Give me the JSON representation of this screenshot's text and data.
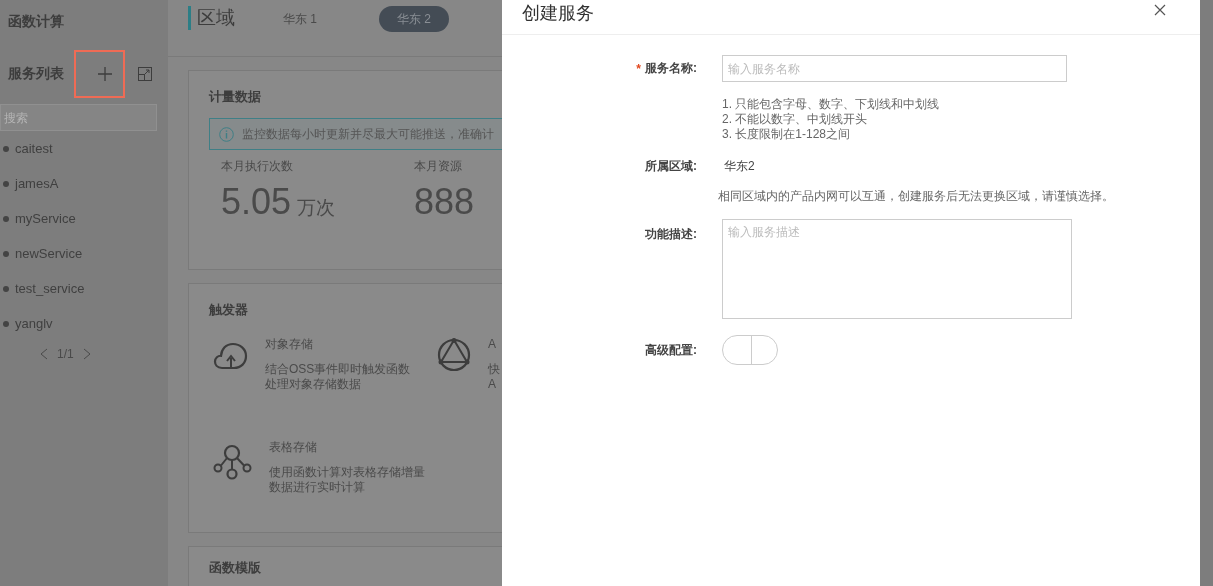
{
  "sidebar": {
    "title": "函数计算",
    "section_title": "服务列表",
    "add_highlighted": true,
    "search": {
      "placeholder": "搜索"
    },
    "services": [
      {
        "name": "caitest"
      },
      {
        "name": "jamesA"
      },
      {
        "name": "myService"
      },
      {
        "name": "newService"
      },
      {
        "name": "test_service"
      },
      {
        "name": "yanglv"
      }
    ],
    "pager": "1/1"
  },
  "header": {
    "title": "区域",
    "regions": [
      {
        "label": "华东 1",
        "selected": false
      },
      {
        "label": "华东 2",
        "selected": true
      }
    ]
  },
  "metrics": {
    "title": "计量数据",
    "notice": "监控数据每小时更新并尽最大可能推送，准确计",
    "stats": [
      {
        "label": "本月执行次数",
        "value": "5.05",
        "unit": "万次"
      },
      {
        "label": "本月资源",
        "value": "888"
      }
    ]
  },
  "triggers": {
    "title": "触发器",
    "items": [
      {
        "kind": "cloud",
        "name": "对象存储",
        "description": [
          "结合OSS事件即时触发函数",
          "处理对象存储数据"
        ]
      },
      {
        "kind": "api",
        "name": "A",
        "description": [
          "快",
          "A"
        ]
      },
      {
        "kind": "table",
        "name": "表格存储",
        "description": [
          "使用函数计算对表格存储增量",
          "数据进行实时计算"
        ]
      }
    ]
  },
  "templates": {
    "title": "函数模版"
  },
  "dialog": {
    "title": "创建服务",
    "name": {
      "label": "服务名称:",
      "required_mark": "*",
      "placeholder": "输入服务名称",
      "hints": [
        "1. 只能包含字母、数字、下划线和中划线",
        "2. 不能以数字、中划线开头",
        "3. 长度限制在1-128之间"
      ]
    },
    "region": {
      "label": "所属区域:",
      "value": "华东2",
      "note": "相同区域内的产品内网可以互通，创建服务后无法更换区域，请谨慎选择。"
    },
    "description": {
      "label": "功能描述:",
      "placeholder": "输入服务描述"
    },
    "advanced": {
      "label": "高级配置:",
      "on": false
    }
  }
}
